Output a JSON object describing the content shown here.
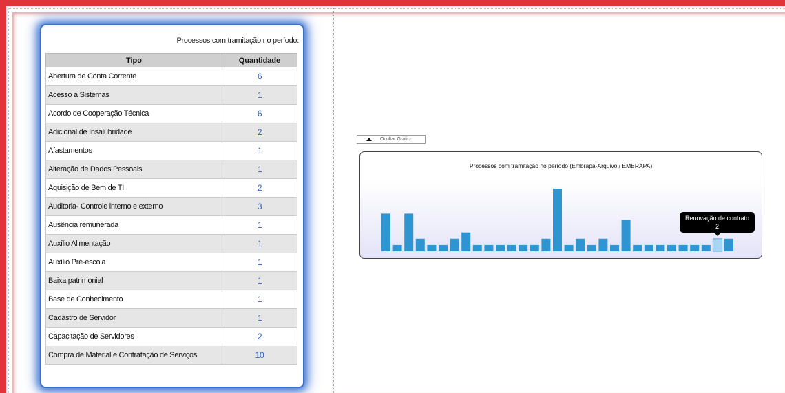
{
  "table": {
    "caption": "Processos com tramitação no período:",
    "headers": {
      "tipo": "Tipo",
      "quantidade": "Quantidade"
    },
    "rows": [
      {
        "tipo": "Abertura de Conta Corrente",
        "qtd": "6"
      },
      {
        "tipo": "Acesso a Sistemas",
        "qtd": "1"
      },
      {
        "tipo": "Acordo de Cooperação Técnica",
        "qtd": "6"
      },
      {
        "tipo": "Adicional de Insalubridade",
        "qtd": "2"
      },
      {
        "tipo": "Afastamentos",
        "qtd": "1"
      },
      {
        "tipo": "Alteração de Dados Pessoais",
        "qtd": "1"
      },
      {
        "tipo": "Aquisição de Bem de TI",
        "qtd": "2"
      },
      {
        "tipo": "Auditoria- Controle interno e externo",
        "qtd": "3"
      },
      {
        "tipo": "Ausência remunerada",
        "qtd": "1"
      },
      {
        "tipo": "Auxílio Alimentação",
        "qtd": "1"
      },
      {
        "tipo": "Auxílio Pré-escola",
        "qtd": "1"
      },
      {
        "tipo": "Baixa patrimonial",
        "qtd": "1"
      },
      {
        "tipo": "Base de Conhecimento",
        "qtd": "1"
      },
      {
        "tipo": "Cadastro de Servidor",
        "qtd": "1"
      },
      {
        "tipo": "Capacitação de Servidores",
        "qtd": "2"
      },
      {
        "tipo": "Compra de Material e Contratação de Serviços",
        "qtd": "10"
      }
    ]
  },
  "chart_toggle": {
    "label": "Ocultar Gráfico",
    "icon": "triangle-up-icon"
  },
  "chart_data": {
    "type": "bar",
    "title": "Processos com tramitação no período (Embrapa-Arquivo / EMBRAPA)",
    "values": [
      6,
      1,
      6,
      2,
      1,
      1,
      2,
      3,
      1,
      1,
      1,
      1,
      1,
      1,
      2,
      10,
      1,
      2,
      1,
      2,
      1,
      5,
      1,
      1,
      1,
      1,
      1,
      1,
      1,
      2,
      2
    ],
    "highlighted_index": 29,
    "colors": {
      "bar": "#2e95d1",
      "highlight": "#a9d6f3"
    },
    "tooltip": {
      "label": "Renovação de contrato",
      "value": "2"
    }
  },
  "colors": {
    "frame": "#e0333a",
    "panel_glow": "#4a7fd6",
    "link": "#2a5fbf"
  }
}
